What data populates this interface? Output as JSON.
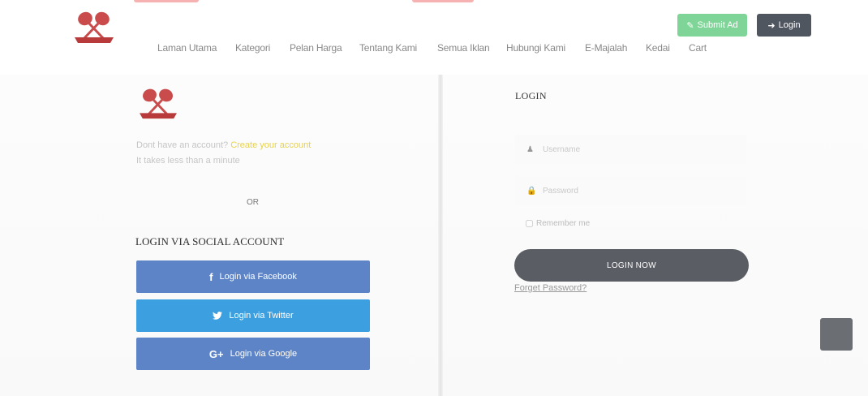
{
  "header": {
    "submit_ad_label": "Submit Ad",
    "login_label": "Login",
    "nav_items": [
      "Laman Utama",
      "Kategori",
      "Pelan Harga",
      "Tentang Kami",
      "Semua Iklan",
      "Hubungi Kami",
      "E-Majalah",
      "Kedai",
      "Cart"
    ]
  },
  "left": {
    "account_prompt": "Dont have an account?",
    "create_account_link": "Create your account",
    "takes_less": "It takes less than a minute",
    "or_text": "OR",
    "social_title": "LOGIN VIA SOCIAL ACCOUNT",
    "facebook_label": "Login via Facebook",
    "twitter_label": "Login via Twitter",
    "google_label": "Login via Google"
  },
  "right": {
    "title": "LOGIN",
    "username_placeholder": "Username",
    "password_placeholder": "Password",
    "remember_label": "Remember me",
    "login_now_label": "LOGIN NOW",
    "forget_label": "Forget Password?"
  },
  "colors": {
    "submit_green": "#7fd597",
    "dark_button": "#4f5660",
    "facebook_blue": "#5d84c7",
    "twitter_blue": "#3c9fe0",
    "link_yellow": "#e7d24b"
  },
  "icons": {
    "logo": "crossed-rackets-logo",
    "submit": "edit-icon",
    "login": "sign-in-icon",
    "facebook": "facebook-icon",
    "twitter": "twitter-icon",
    "google": "google-plus-icon",
    "user": "user-icon",
    "lock": "lock-icon",
    "scroll": "scroll-top-icon"
  }
}
